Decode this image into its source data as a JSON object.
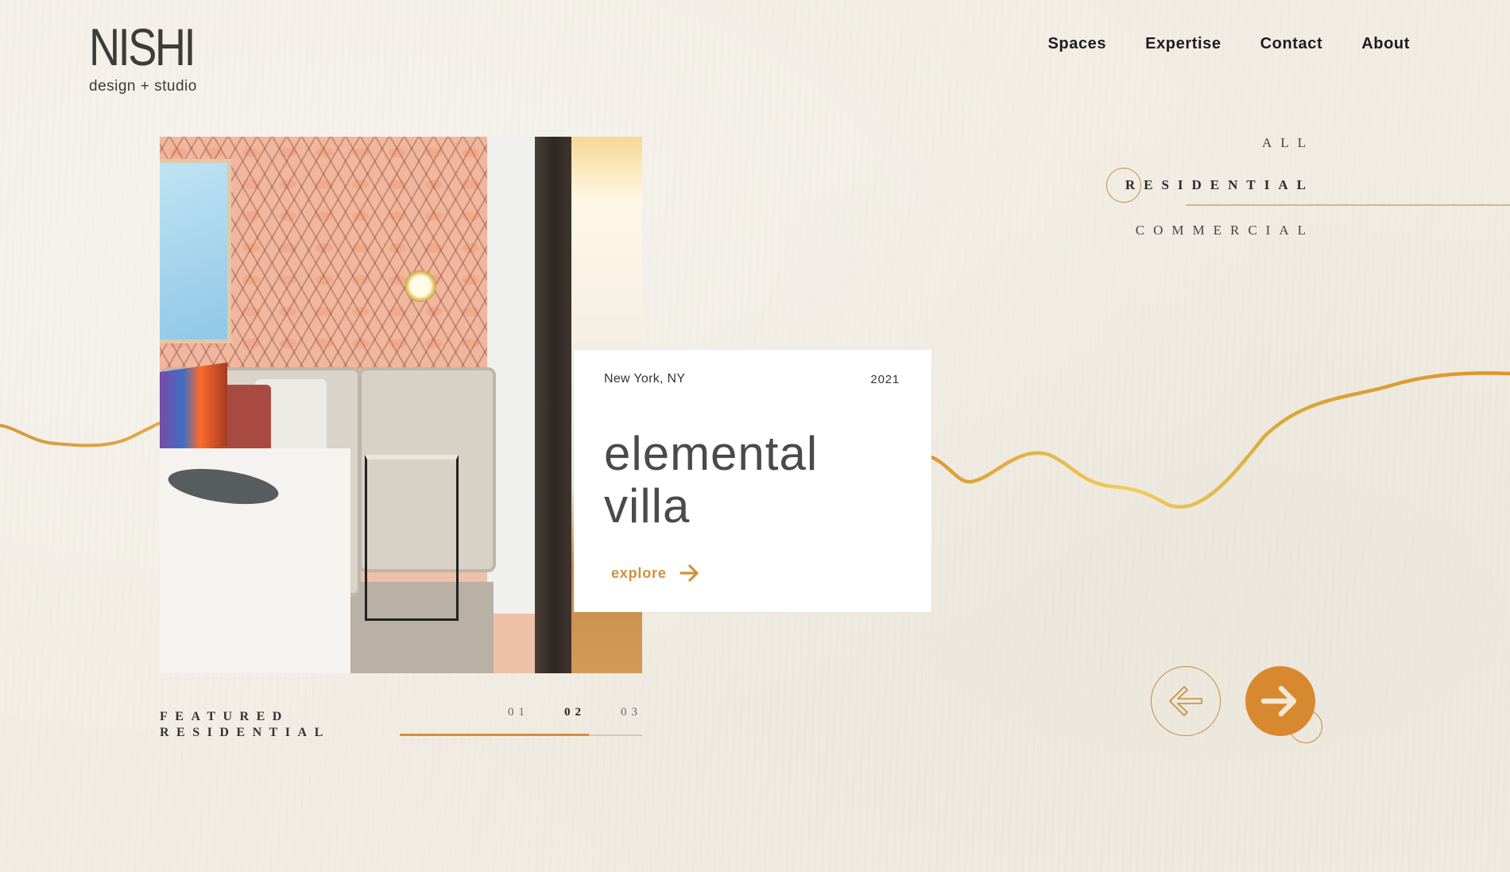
{
  "brand": {
    "name": "NISHI",
    "tagline": "design + studio"
  },
  "nav": {
    "items": [
      "Spaces",
      "Expertise",
      "Contact",
      "About"
    ]
  },
  "filters": {
    "items": [
      "ALL",
      "RESIDENTIAL",
      "COMMERCIAL"
    ],
    "active": "RESIDENTIAL"
  },
  "project": {
    "location": "New York, NY",
    "year": "2021",
    "title_line1": "elemental",
    "title_line2": "villa",
    "explore_label": "explore"
  },
  "section": {
    "line1": "FEATURED",
    "line2": "RESIDENTIAL"
  },
  "pager": {
    "items": [
      "01",
      "02",
      "03"
    ],
    "current": "02",
    "progress": 0.78
  },
  "controls": {
    "prev_icon": "arrow-left-icon",
    "next_icon": "arrow-right-icon"
  },
  "colors": {
    "accent": "#d8892f",
    "background": "#f1ede4",
    "text": "#1d1d1b",
    "card": "#ffffff"
  }
}
